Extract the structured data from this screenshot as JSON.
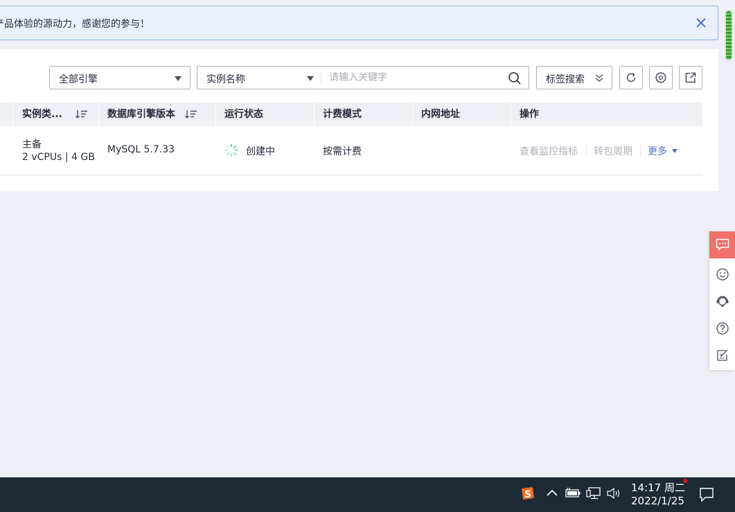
{
  "notice": {
    "text": "产品体验的源动力，感谢您的参与！"
  },
  "filters": {
    "engine_select": "全部引擎",
    "field_select": "实例名称",
    "search_placeholder": "请输入关键字",
    "tag_search": "标签搜索"
  },
  "table": {
    "headers": [
      "实例类...",
      "数据库引擎版本",
      "运行状态",
      "计费模式",
      "内网地址",
      "操作"
    ],
    "row": {
      "instance_type": "主备",
      "spec": "2 vCPUs | 4 GB",
      "engine_version": "MySQL 5.7.33",
      "status": "创建中",
      "billing": "按需计费",
      "private_ip": "",
      "actions": [
        "查看监控指标",
        "转包周期",
        "更多"
      ]
    }
  },
  "colors": {
    "accent": "#526ecc",
    "sidebar_active": "#f0706a",
    "status_spinner": "#50d4ab"
  },
  "sidebar_icons": [
    "chat-icon",
    "smile-feedback-icon",
    "customer-service-icon",
    "help-icon",
    "edit-note-icon"
  ],
  "taskbar": {
    "ime_label": "S",
    "time": "14:17 周二",
    "date": "2022/1/25"
  }
}
